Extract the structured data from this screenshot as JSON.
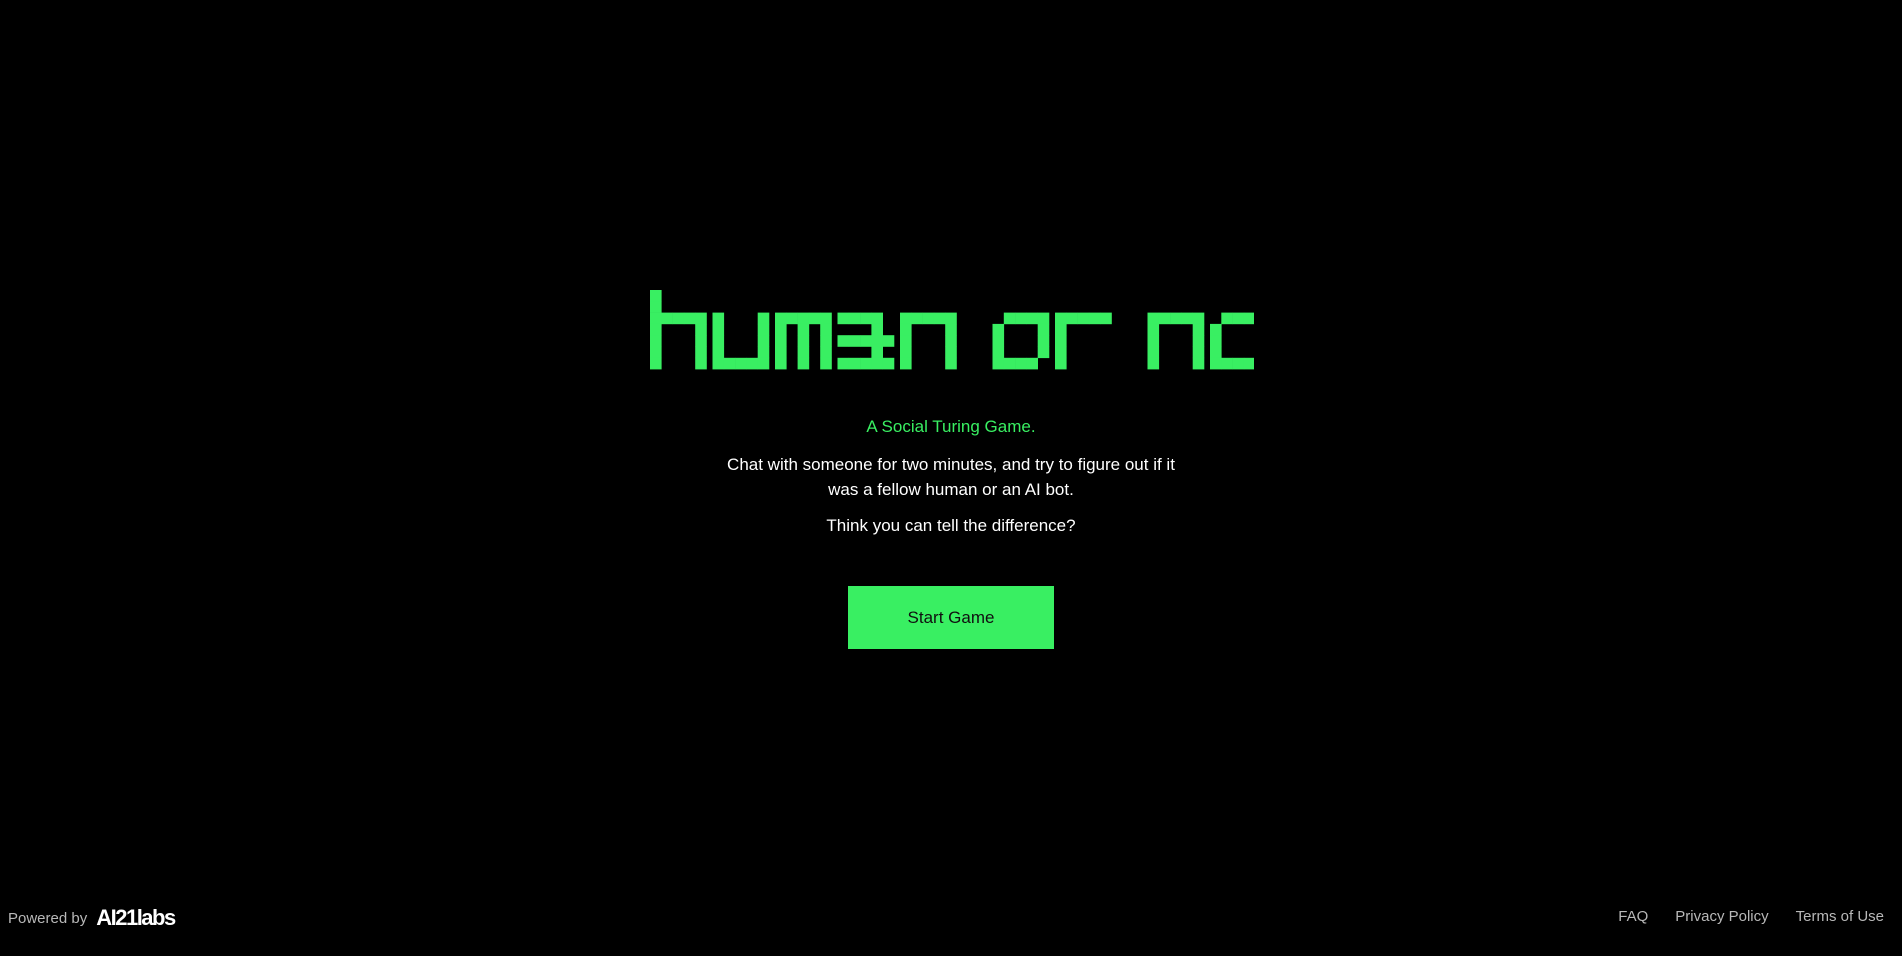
{
  "hero": {
    "logo_text": "human or not?",
    "tagline": "A Social Turing Game.",
    "description": "Chat with someone for two minutes, and try to figure out if it was a fellow human or an AI bot.",
    "question": "Think you can tell the difference?",
    "start_button_label": "Start Game"
  },
  "footer": {
    "powered_by_label": "Powered by",
    "brand": "AI21labs",
    "links": [
      "FAQ",
      "Privacy Policy",
      "Terms of Use"
    ]
  },
  "colors": {
    "background": "#000000",
    "accent": "#39ef62",
    "text": "#ffffff",
    "muted": "#b8b8b8"
  }
}
